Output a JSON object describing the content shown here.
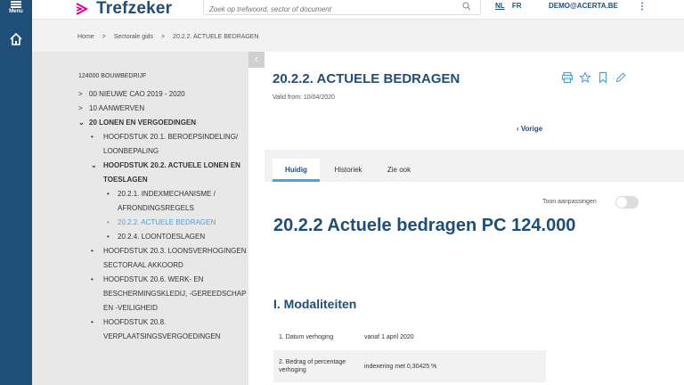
{
  "rail": {
    "menu_label": "Menu"
  },
  "header": {
    "brand": "Trefzeker",
    "search_placeholder": "Zoek op trefwoord, sector of document",
    "lang_nl": "NL",
    "lang_fr": "FR",
    "user": "DEMO@ACERTA.BE",
    "kebab": "⋮"
  },
  "breadcrumb": {
    "items": [
      "Home",
      "Sectorale gids",
      "20.2.2. ACTUELE BEDRAGEN"
    ],
    "sep": ">"
  },
  "sidebar": {
    "collapse_glyph": "‹",
    "root": "124000 BOUWBEDRIJF",
    "items": [
      {
        "label": "00 NIEUWE CAO 2019 - 2020",
        "chev": ">"
      },
      {
        "label": "10 AANWERVEN",
        "chev": ">"
      },
      {
        "label": "20 LONEN EN VERGOEDINGEN",
        "chev": "⌄"
      },
      {
        "label": "HOOFDSTUK 20.1. BEROEPSINDELING/ LOONBEPALING",
        "bul": "•"
      },
      {
        "label": "HOOFDSTUK 20.2. ACTUELE LONEN EN TOESLAGEN",
        "chev": "⌄"
      },
      {
        "label": "20.2.1. INDEXMECHANISME / AFRONDINGSREGELS",
        "bul": "•"
      },
      {
        "label": "20.2.2. ACTUELE BEDRAGEN",
        "bul": "•"
      },
      {
        "label": "20.2.4. LOONTOESLAGEN",
        "bul": "•"
      },
      {
        "label": "HOOFDSTUK 20.3. LOONSVERHOGINGEN SECTORAAL AKKOORD",
        "bul": "•"
      },
      {
        "label": "HOOFDSTUK 20.6. WERK- EN BESCHERMINGSKLEDIJ, -GEREEDSCHAP EN -VEILIGHEID",
        "bul": "•"
      },
      {
        "label": "HOOFDSTUK 20.8. VERPLAATSINGSVERGOEDINGEN",
        "bul": "•"
      }
    ]
  },
  "main": {
    "title": "20.2.2. ACTUELE BEDRAGEN",
    "valid_from": "Valid from: 10/04/2020",
    "prev": "‹ Vorige",
    "tabs": [
      "Huidig",
      "Historiek",
      "Zie ook"
    ],
    "toggle_label": "Toon aanpassingen",
    "heading": "20.2.2 Actuele bedragen PC 124.000",
    "section": "I. Modaliteiten",
    "table": [
      {
        "label": "1. Datum verhoging",
        "value": "vanaf 1 april 2020"
      },
      {
        "label": "2. Bedrag of percentage verhoging",
        "value": "indexering met 0,30425 %"
      }
    ]
  },
  "colors": {
    "primary": "#1f4e79",
    "accent": "#e6007e",
    "link": "#4aa3df"
  }
}
